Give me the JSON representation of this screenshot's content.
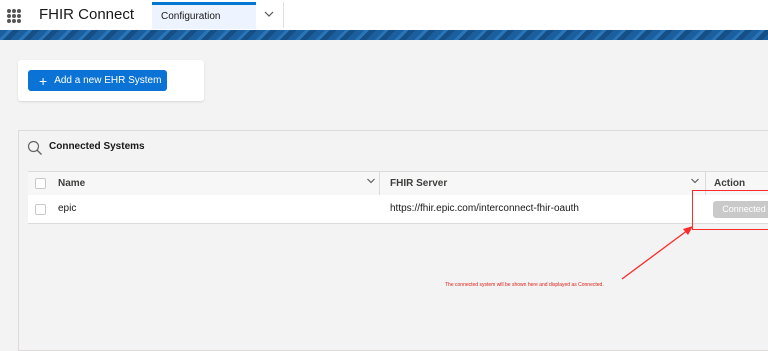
{
  "app": {
    "name": "FHIR Connect",
    "tab_label": "Configuration"
  },
  "actions": {
    "add_label": "Add a new EHR System"
  },
  "panel": {
    "title": "Connected Systems",
    "columns": [
      "Name",
      "FHIR Server",
      "Action"
    ],
    "rows": [
      {
        "name": "epic",
        "fhir_server": "https://fhir.epic.com/interconnect-fhir-oauth",
        "action_label": "Connected"
      }
    ]
  },
  "annotation": {
    "text": "The connected system will be shown here and displayed as Connected.",
    "color": "#e3211b"
  },
  "colors": {
    "brand": "#0b73d6",
    "banner": "#1b5f9e",
    "disabled_button": "#c9c9c9"
  }
}
